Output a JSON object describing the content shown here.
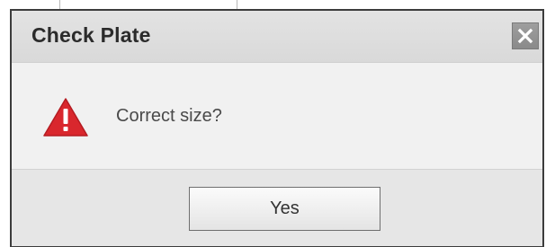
{
  "dialog": {
    "title": "Check Plate",
    "message": "Correct size?",
    "yes_label": "Yes",
    "close_icon": "close-icon",
    "alert_icon": "warning-triangle-icon"
  },
  "colors": {
    "alert_red": "#d9272d",
    "titlebar_bg": "#dedede",
    "dialog_border": "#3c3c3c"
  }
}
